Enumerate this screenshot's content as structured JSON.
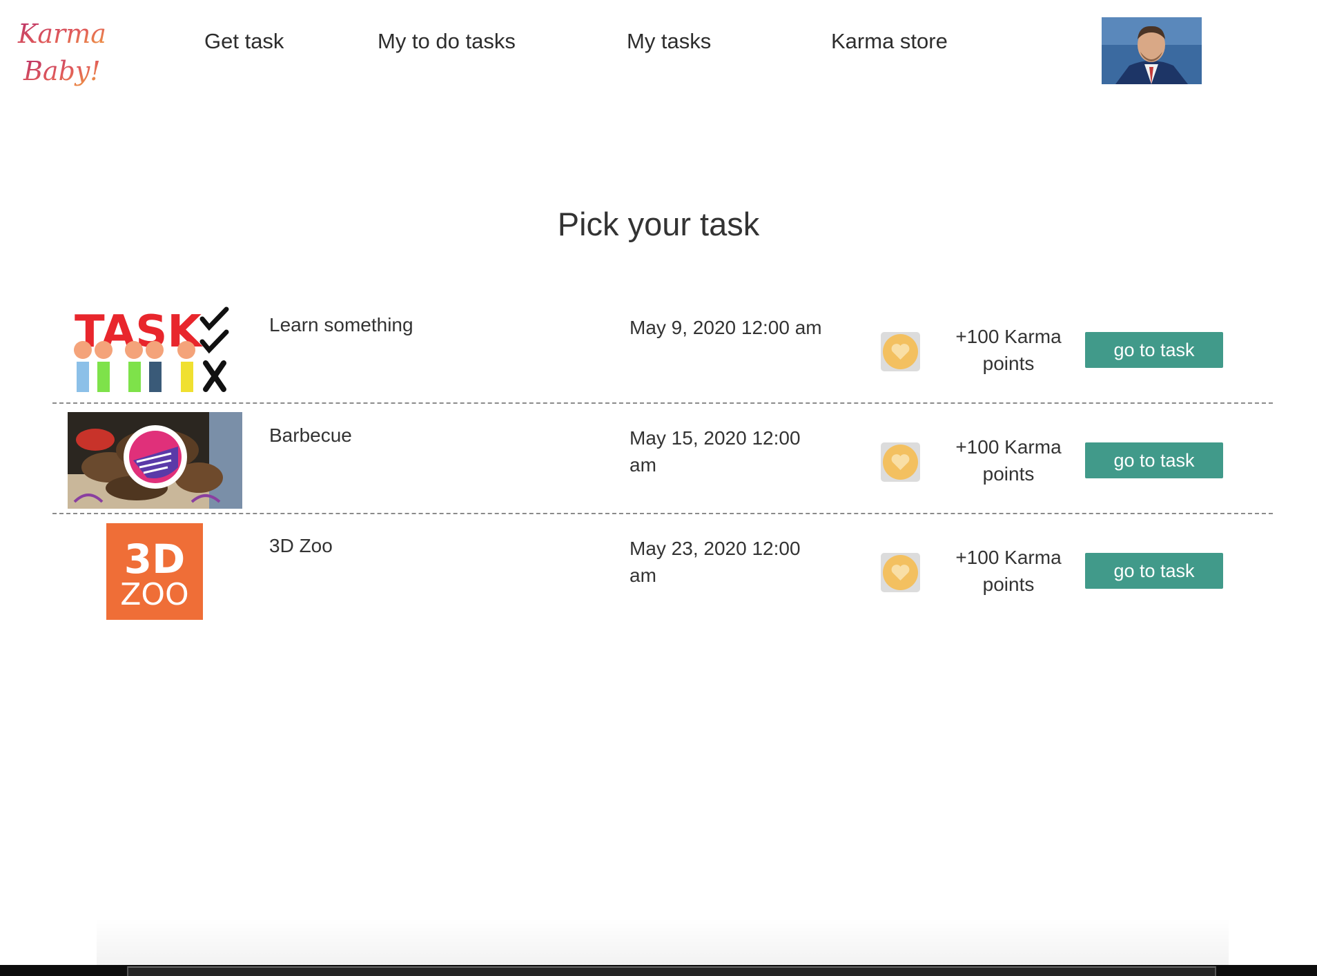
{
  "app": {
    "logo_text_line1": "Karma",
    "logo_text_line2": "Baby!"
  },
  "nav": {
    "items": [
      {
        "label": "Get task"
      },
      {
        "label": "My to do tasks"
      },
      {
        "label": "My tasks"
      },
      {
        "label": "Karma store"
      }
    ]
  },
  "page": {
    "title": "Pick your task"
  },
  "tasks": [
    {
      "name": "Learn something",
      "date": "May 9, 2020 12:00 am",
      "reward": "+100 Karma points",
      "button_label": "go to task",
      "image_icon": "task-checklist-image",
      "image_text": "TASK"
    },
    {
      "name": "Barbecue",
      "date": "May 15, 2020 12:00 am",
      "reward": "+100 Karma points",
      "button_label": "go to task",
      "image_icon": "barbecue-photo"
    },
    {
      "name": "3D Zoo",
      "date": "May 23, 2020 12:00 am",
      "reward": "+100 Karma points",
      "button_label": "go to task",
      "image_icon": "3d-zoo-logo",
      "image_text_line1": "3D",
      "image_text_line2": "ZOO"
    }
  ],
  "colors": {
    "accent_button": "#419a8a",
    "favorite_circle": "#f3c060",
    "favorite_bg": "#dcdcdc",
    "zoo_orange": "#ef6e37",
    "logo_pink": "#d2506e"
  }
}
